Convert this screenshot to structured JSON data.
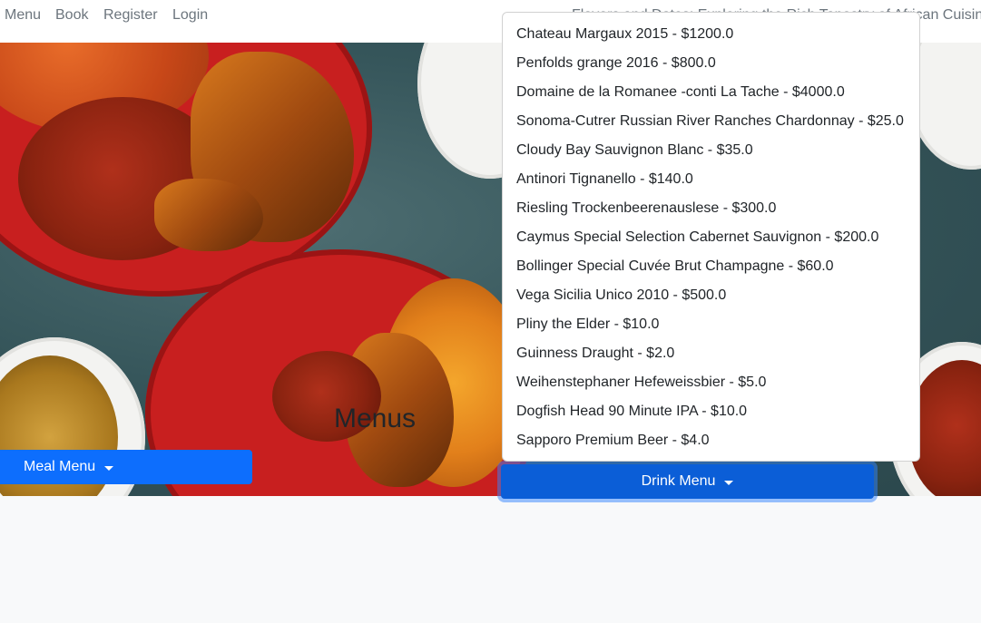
{
  "nav": {
    "links": [
      "Menu",
      "Book",
      "Register",
      "Login"
    ],
    "tagline": "Flavors and Dates: Exploring the Rich Tapestry of African Cuisine"
  },
  "hero": {
    "title": "Menus",
    "meal_button": "Meal Menu",
    "drink_button": "Drink Menu"
  },
  "drink_menu": {
    "items": [
      "Chateau Margaux 2015 - $1200.0",
      "Penfolds grange 2016 - $800.0",
      "Domaine de la Romanee -conti La Tache - $4000.0",
      "Sonoma-Cutrer Russian River Ranches Chardonnay - $25.0",
      "Cloudy Bay Sauvignon Blanc - $35.0",
      "Antinori Tignanello - $140.0",
      "Riesling Trockenbeerenauslese - $300.0",
      "Caymus Special Selection Cabernet Sauvignon - $200.0",
      "Bollinger Special Cuvée Brut Champagne - $60.0",
      "Vega Sicilia Unico 2010 - $500.0",
      "Pliny the Elder - $10.0",
      "Guinness Draught - $2.0",
      "Weihenstephaner Hefeweissbier - $5.0",
      "Dogfish Head 90 Minute IPA - $10.0",
      "Sapporo Premium Beer - $4.0"
    ]
  },
  "colors": {
    "primary": "#0d6efd",
    "primary_active": "#0b5ed7",
    "page_background": "#f8f9fa",
    "nav_text": "#6c757d"
  }
}
